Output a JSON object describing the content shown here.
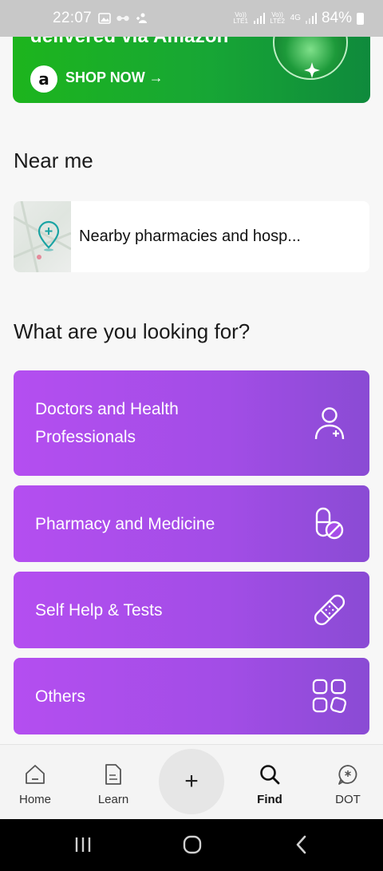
{
  "status_bar": {
    "time": "22:07",
    "sim1_label": "Vo)) LTE1",
    "sim2_label": "Vo)) LTE2",
    "network": "4G",
    "battery": "84%"
  },
  "banner": {
    "headline": "delivered via Amazon",
    "badge_letter": "a",
    "cta": "SHOP NOW →",
    "colors": {
      "start": "#1db51d",
      "end": "#0f8a3c"
    }
  },
  "near_me": {
    "title": "Near me",
    "card_label": "Nearby pharmacies and hosp..."
  },
  "looking_for": {
    "title": "What are you looking for?",
    "items": [
      {
        "label": "Doctors and Health\nProfessionals",
        "icon": "doctor-add-icon"
      },
      {
        "label": "Pharmacy and Medicine",
        "icon": "pill-icon"
      },
      {
        "label": "Self Help & Tests",
        "icon": "bandage-icon"
      },
      {
        "label": "Others",
        "icon": "grid-icon"
      }
    ],
    "accent": "#b44ef0"
  },
  "bottom_nav": {
    "items": [
      {
        "label": "Home",
        "icon": "home-icon"
      },
      {
        "label": "Learn",
        "icon": "document-icon"
      },
      {
        "label": "Find",
        "icon": "search-icon"
      },
      {
        "label": "DOT",
        "icon": "chat-bubble-icon"
      }
    ],
    "active": "Find",
    "fab_symbol": "+"
  }
}
